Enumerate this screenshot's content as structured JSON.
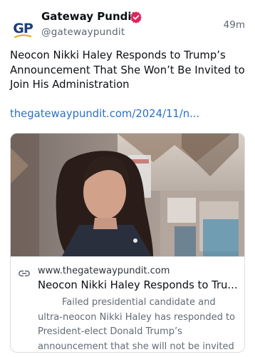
{
  "author": {
    "avatar_text": "GP",
    "name": "Gateway Pundit",
    "handle": "@gatewaypundit",
    "timestamp": "49m"
  },
  "post": {
    "text": "Neocon Nikki Haley Responds to Trump’s Announcement That She Won’t Be Invited to Join His Administration",
    "link": "thegatewaypundit.com/2024/11/n..."
  },
  "card": {
    "domain": "www.thegatewaypundit.com",
    "title": "Neocon Nikki Haley Responds to Tru...",
    "description": "Failed presidential candidate and ultra-neocon Nikki Haley has responded to President-elect Donald Trump’s announcement that she will not be invited to..."
  },
  "colors": {
    "link": "#2a70c7",
    "verified": "#e0245e",
    "avatar": "#1f3f77",
    "avatar_swoosh": "#e1a32a"
  },
  "icons": {
    "verified": "verified-badge-icon",
    "link": "link-icon"
  }
}
